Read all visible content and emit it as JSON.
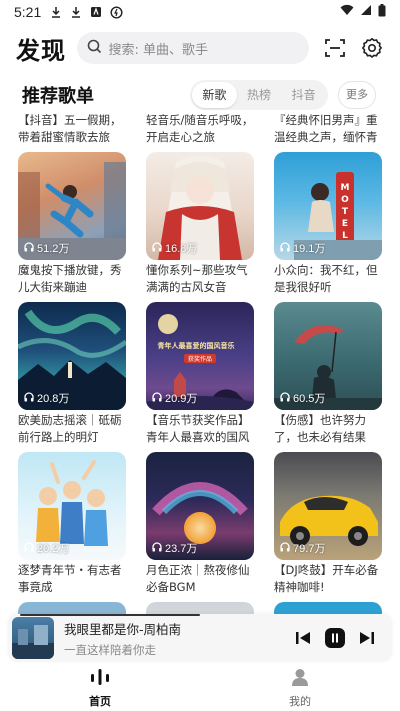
{
  "status": {
    "time": "5:21",
    "left_icons": [
      "download-icon",
      "download-icon",
      "app-icon",
      "data-saver-icon"
    ],
    "right_icons": [
      "wifi-icon",
      "cellular-icon",
      "battery-icon"
    ]
  },
  "header": {
    "logo": "发现",
    "search_placeholder": "搜索: 单曲、歌手",
    "icons": [
      "scan-icon",
      "settings-icon"
    ]
  },
  "section": {
    "title": "推荐歌单",
    "tabs": [
      {
        "label": "新歌",
        "active": true
      },
      {
        "label": "热榜",
        "active": false
      },
      {
        "label": "抖音",
        "active": false
      }
    ],
    "more_label": "更多"
  },
  "top_captions": [
    "【抖音】五一假期，带着甜蜜情歌去旅行!",
    "轻音乐/随音乐呼吸，开启走心之旅",
    "『经典怀旧男声』重温经典之声，缅怀青春年"
  ],
  "playlists": [
    {
      "plays": "51.2万",
      "caption": "魔鬼按下播放键，秀儿大街来蹦迪"
    },
    {
      "plays": "16.8万",
      "caption": "懂你系列~那些攻气满满的古风女音"
    },
    {
      "plays": "19.1万",
      "caption": "小众向：我不红，但是我很好听"
    },
    {
      "plays": "20.8万",
      "caption": "欧美励志摇滚｜砥砺前行路上的明灯"
    },
    {
      "plays": "20.9万",
      "caption": "【音乐节获奖作品】青年人最喜欢的国风音乐"
    },
    {
      "plays": "60.5万",
      "caption": "【伤感】也许努力了，也未必有结果"
    },
    {
      "plays": "20.2万",
      "caption": "逐梦青年节・有志者事竟成"
    },
    {
      "plays": "23.7万",
      "caption": "月色正浓｜熬夜修仙必备BGM"
    },
    {
      "plays": "79.7万",
      "caption": "【DJ咚鼓】开车必备精神咖啡!"
    }
  ],
  "cover_texts": {
    "motel": "MOTEL",
    "poster_line": "青年人最喜爱的国风音乐",
    "poster_badge": "获奖作品"
  },
  "player": {
    "song": "我眼里都是你-周柏南",
    "lyric": "一直这样陪着你走",
    "controls": [
      "previous-icon",
      "pause-icon",
      "next-icon"
    ]
  },
  "tabbar": [
    {
      "label": "首页",
      "icon": "home-wave-icon",
      "active": true
    },
    {
      "label": "我的",
      "icon": "user-icon",
      "active": false
    }
  ]
}
